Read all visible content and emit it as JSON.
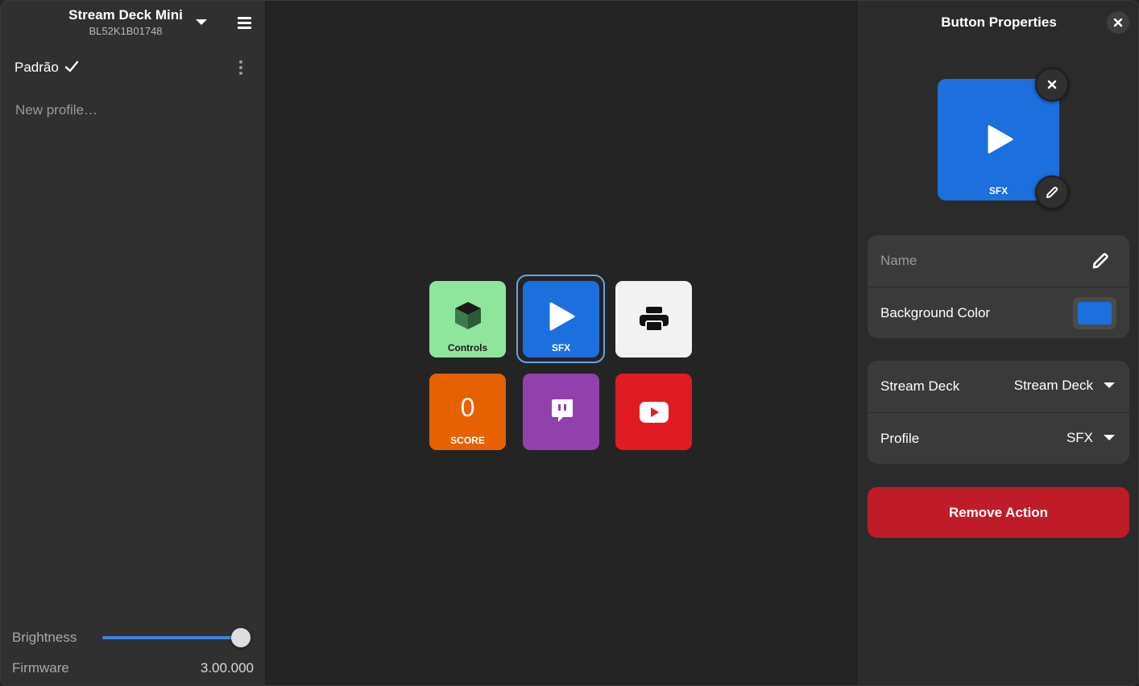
{
  "device": {
    "name": "Stream Deck Mini",
    "serial": "BL52K1B01748"
  },
  "profiles": {
    "current": "Padrão",
    "new_placeholder": "New profile…"
  },
  "footer": {
    "brightness_label": "Brightness",
    "brightness_value": 0.93,
    "firmware_label": "Firmware",
    "firmware_value": "3.00.000"
  },
  "deck": {
    "keys": [
      {
        "label": "Controls",
        "icon": "cube-icon",
        "bg": "#8fe59c"
      },
      {
        "label": "SFX",
        "icon": "play-icon",
        "bg": "#1c6fdc",
        "selected": true
      },
      {
        "label": "",
        "icon": "printer-icon",
        "bg": "#f2f2f2"
      },
      {
        "label": "SCORE",
        "value": "0",
        "icon": "",
        "bg": "#e66100"
      },
      {
        "label": "",
        "icon": "twitch-icon",
        "bg": "#9141ac"
      },
      {
        "label": "",
        "icon": "youtube-icon",
        "bg": "#e01b24"
      }
    ]
  },
  "panel": {
    "title": "Button Properties",
    "preview_label": "SFX",
    "name_placeholder": "Name",
    "background_color_label": "Background Color",
    "background_color": "#1c6fdc",
    "stream_deck_label": "Stream Deck",
    "stream_deck_value": "Stream Deck",
    "profile_label": "Profile",
    "profile_value": "SFX",
    "remove_label": "Remove Action"
  },
  "colors": {
    "accent": "#3c84e0",
    "destructive": "#c01c28"
  }
}
